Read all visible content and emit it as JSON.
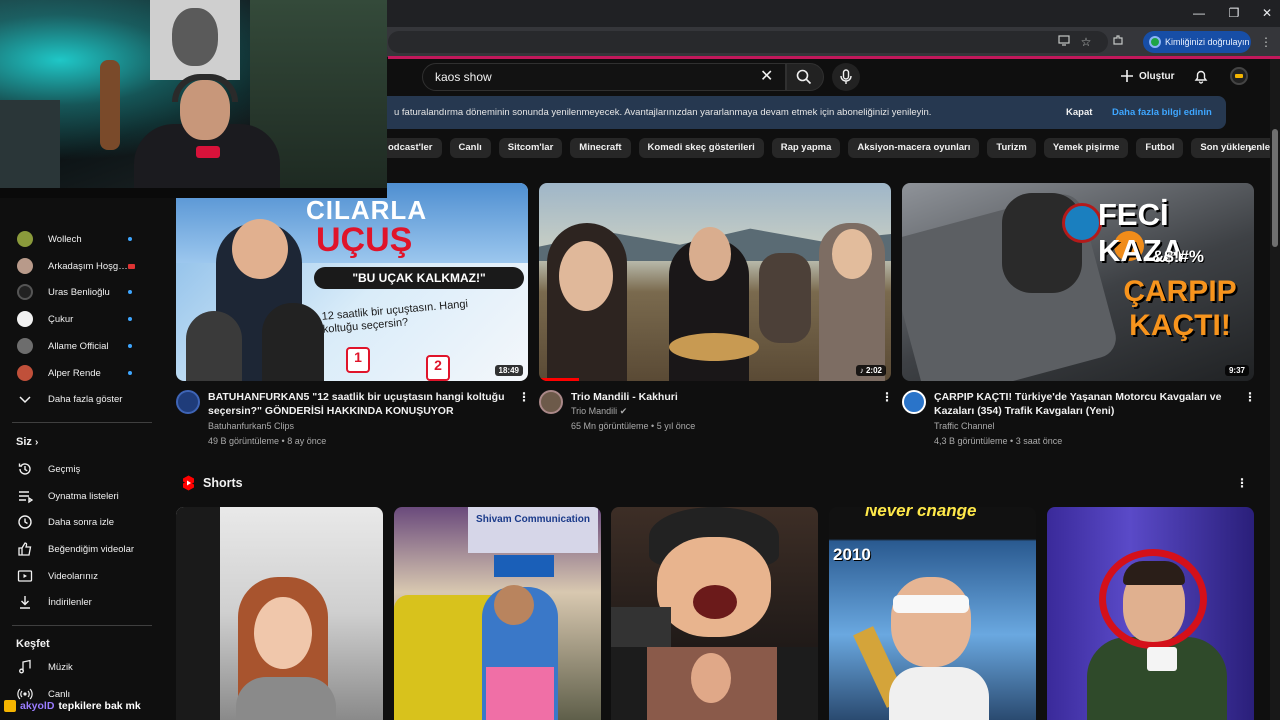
{
  "browser": {
    "window_controls": [
      "—",
      "❐",
      "✕"
    ],
    "verify_button": "Kimliğinizi doğrulayın"
  },
  "header": {
    "search_query": "kaos show",
    "create_label": "Oluştur"
  },
  "banner": {
    "text": "u faturalandırma döneminin sonunda yenilenmeyecek. Avantajlarınızdan yararlanmaya devam etmek için aboneliğinizi yenileyin.",
    "dismiss": "Kapat",
    "learn_more": "Daha fazla bilgi edinin"
  },
  "chips": [
    "odcast'ler",
    "Canlı",
    "Sitcom'lar",
    "Minecraft",
    "Komedi skeç gösterileri",
    "Rap yapma",
    "Aksiyon-macera oyunları",
    "Turizm",
    "Yemek pişirme",
    "Futbol",
    "Son yüklenenler"
  ],
  "sidebar": {
    "subscriptions": [
      {
        "label": "Wollech"
      },
      {
        "label": "Arkadaşım Hoşg…"
      },
      {
        "label": "Uras Benlioğlu"
      },
      {
        "label": "Çukur"
      },
      {
        "label": "Allame Official"
      },
      {
        "label": "Alper Rende"
      }
    ],
    "show_more": "Daha fazla göster",
    "you_heading": "Siz",
    "you_items": [
      {
        "label": "Geçmiş",
        "icon": "history-icon"
      },
      {
        "label": "Oynatma listeleri",
        "icon": "playlist-icon"
      },
      {
        "label": "Daha sonra izle",
        "icon": "clock-icon"
      },
      {
        "label": "Beğendiğim videolar",
        "icon": "thumbs-up-icon"
      },
      {
        "label": "Videolarınız",
        "icon": "video-icon"
      },
      {
        "label": "İndirilenler",
        "icon": "download-icon"
      }
    ],
    "explore_heading": "Keşfet",
    "explore_items": [
      {
        "label": "Müzik",
        "icon": "music-icon"
      },
      {
        "label": "Canlı",
        "icon": "live-icon"
      }
    ]
  },
  "videos": [
    {
      "title": "BATUHANFURKAN5 \"12 saatlik bir uçuştasın hangi koltuğu seçersin?\" GÖNDERİSİ HAKKINDA KONUŞUYOR",
      "channel": "Batuhanfurkan5 Clips",
      "meta": "49 B görüntüleme • 8 ay önce",
      "duration": "18:49",
      "thumb_title": "UÇUŞ",
      "thumb_title_prefix": "CILARLA",
      "thumb_quote": "\"BU UÇAK KALKMAZ!\"",
      "thumb_note": "12 saatlik bir uçuştasın. Hangi koltuğu seçersin?"
    },
    {
      "title": "Trio Mandili - Kakhuri",
      "channel": "Trio Mandili",
      "meta": "65 Mn görüntüleme • 5 yıl önce",
      "duration": "2:02"
    },
    {
      "title": "ÇARPIP KAÇTI! Türkiye'de Yaşanan Motorcu Kavgaları ve Kazaları (354) Trafik Kavgaları (Yeni)",
      "channel": "Traffic Channel",
      "meta": "4,3 B görüntüleme • 3 saat önce",
      "duration": "9:37",
      "thumb_title": "FECİ KAZA",
      "thumb_symbols": "&$!#%",
      "thumb_title2": "ÇARPIP KAÇTI!"
    }
  ],
  "shorts": {
    "heading": "Shorts",
    "items": [
      {
        "label": ""
      },
      {
        "label": "Shivam Communication"
      },
      {
        "label": ""
      },
      {
        "label": "Never change",
        "year": "2010"
      },
      {
        "label": ""
      }
    ]
  },
  "stream_overlay": {
    "user": "akyolD",
    "message": "tepkilere bak mk"
  },
  "colors": {
    "accent_red": "#ff0000",
    "link_blue": "#3ea6ff",
    "banner_bg": "#263850"
  }
}
